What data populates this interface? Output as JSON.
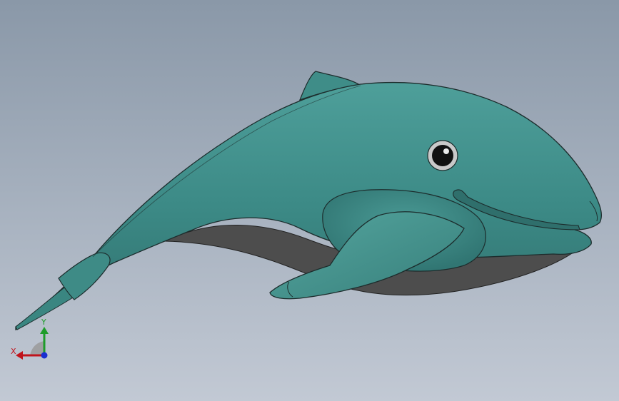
{
  "viewport": {
    "background_top": "#8a98a8",
    "background_bottom": "#c2c9d4"
  },
  "model": {
    "body_color": "#3c8a86",
    "body_highlight": "#5aa8a2",
    "belly_shadow_color": "#4d4d4d",
    "outline_color": "#1c2c2c",
    "eye_icon": "whale-eye"
  },
  "triad": {
    "x_label": "X",
    "y_label": "Y",
    "x_color": "#c0141c",
    "y_color": "#1e9c2a",
    "z_color": "#1a2fd0"
  }
}
